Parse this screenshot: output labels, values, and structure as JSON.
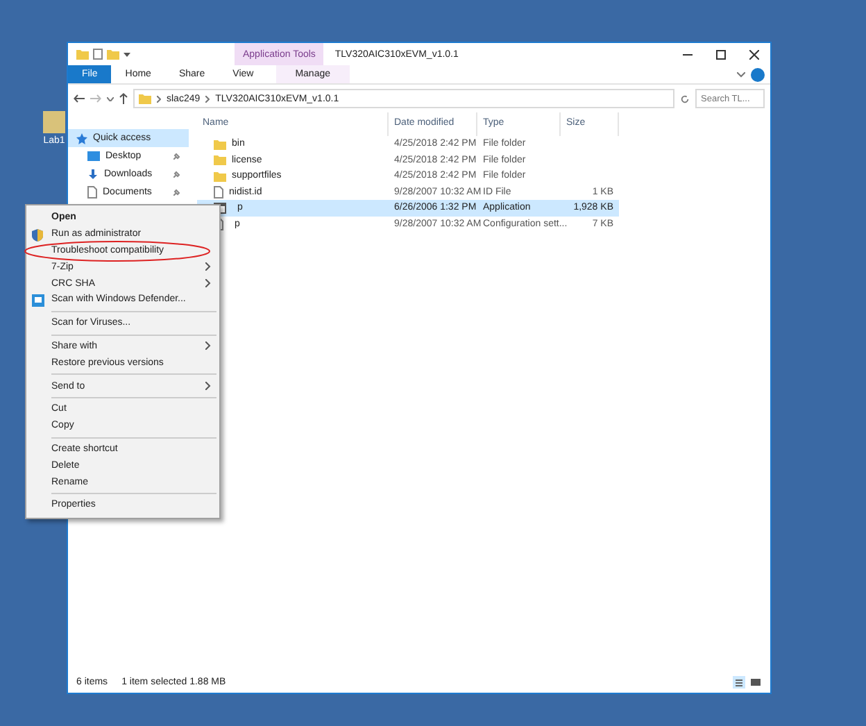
{
  "desktop_icon": {
    "label": "Lab1"
  },
  "window": {
    "title": "TLV320AIC310xEVM_v1.0.1",
    "context_tab": "Application Tools"
  },
  "ribbon_tabs": [
    {
      "label": "File",
      "selected": true,
      "kind": "file"
    },
    {
      "label": "Home",
      "selected": false,
      "kind": "tab"
    },
    {
      "label": "Share",
      "selected": false,
      "kind": "tab"
    },
    {
      "label": "View",
      "selected": false,
      "kind": "tab"
    },
    {
      "label": "Manage",
      "selected": false,
      "kind": "context"
    }
  ],
  "address": {
    "crumbs": [
      "slac249",
      "TLV320AIC310xEVM_v1.0.1"
    ],
    "search_placeholder": "Search TL..."
  },
  "nav": [
    {
      "label": "Quick access",
      "selected": true,
      "kind": "star",
      "pinned": false
    },
    {
      "label": "Desktop",
      "selected": false,
      "kind": "desktop",
      "pinned": true
    },
    {
      "label": "Downloads",
      "selected": false,
      "kind": "download",
      "pinned": true
    },
    {
      "label": "Documents",
      "selected": false,
      "kind": "document",
      "pinned": true
    }
  ],
  "table": {
    "columns": [
      "Name",
      "Date modified",
      "Type",
      "Size"
    ],
    "rows": [
      {
        "kind": "folder",
        "name": "bin",
        "date": "4/25/2018 2:42 PM",
        "type": "File folder",
        "size": "",
        "selected": false
      },
      {
        "kind": "folder",
        "name": "license",
        "date": "4/25/2018 2:42 PM",
        "type": "File folder",
        "size": "",
        "selected": false
      },
      {
        "kind": "folder",
        "name": "supportfiles",
        "date": "4/25/2018 2:42 PM",
        "type": "File folder",
        "size": "",
        "selected": false
      },
      {
        "kind": "file",
        "name": "nidist.id",
        "date": "9/28/2007 10:32 AM",
        "type": "ID File",
        "size": "1 KB",
        "selected": false
      },
      {
        "kind": "app",
        "name": "p",
        "date": "6/26/2006 1:32 PM",
        "type": "Application",
        "size": "1,928 KB",
        "selected": true
      },
      {
        "kind": "config",
        "name": "p",
        "date": "9/28/2007 10:32 AM",
        "type": "Configuration sett...",
        "size": "7 KB",
        "selected": false
      }
    ]
  },
  "status_bar": {
    "count": "6 items",
    "selection": "1 item selected  1.88 MB"
  },
  "context_menu": [
    {
      "kind": "item",
      "label": "Open",
      "bold": true,
      "submenu": false,
      "circled": false
    },
    {
      "kind": "shield",
      "label": "Run as administrator",
      "bold": false,
      "submenu": false,
      "circled": false
    },
    {
      "kind": "item",
      "label": "Troubleshoot compatibility",
      "bold": false,
      "submenu": false,
      "circled": true
    },
    {
      "kind": "item",
      "label": "7-Zip",
      "bold": false,
      "submenu": true,
      "circled": false
    },
    {
      "kind": "item",
      "label": "CRC SHA",
      "bold": false,
      "submenu": true,
      "circled": false
    },
    {
      "kind": "defender",
      "label": "Scan with Windows Defender...",
      "bold": false,
      "submenu": false,
      "circled": false
    },
    {
      "kind": "separator"
    },
    {
      "kind": "item",
      "label": "Scan for Viruses...",
      "bold": false,
      "submenu": false,
      "circled": false
    },
    {
      "kind": "separator"
    },
    {
      "kind": "item",
      "label": "Share with",
      "bold": false,
      "submenu": true,
      "circled": false
    },
    {
      "kind": "item",
      "label": "Restore previous versions",
      "bold": false,
      "submenu": false,
      "circled": false
    },
    {
      "kind": "separator"
    },
    {
      "kind": "item",
      "label": "Send to",
      "bold": false,
      "submenu": true,
      "circled": false
    },
    {
      "kind": "separator"
    },
    {
      "kind": "item",
      "label": "Cut",
      "bold": false,
      "submenu": false,
      "circled": false
    },
    {
      "kind": "item",
      "label": "Copy",
      "bold": false,
      "submenu": false,
      "circled": false
    },
    {
      "kind": "separator"
    },
    {
      "kind": "item",
      "label": "Create shortcut",
      "bold": false,
      "submenu": false,
      "circled": false
    },
    {
      "kind": "item",
      "label": "Delete",
      "bold": false,
      "submenu": false,
      "circled": false
    },
    {
      "kind": "item",
      "label": "Rename",
      "bold": false,
      "submenu": false,
      "circled": false
    },
    {
      "kind": "separator"
    },
    {
      "kind": "item",
      "label": "Properties",
      "bold": false,
      "submenu": false,
      "circled": false
    }
  ]
}
